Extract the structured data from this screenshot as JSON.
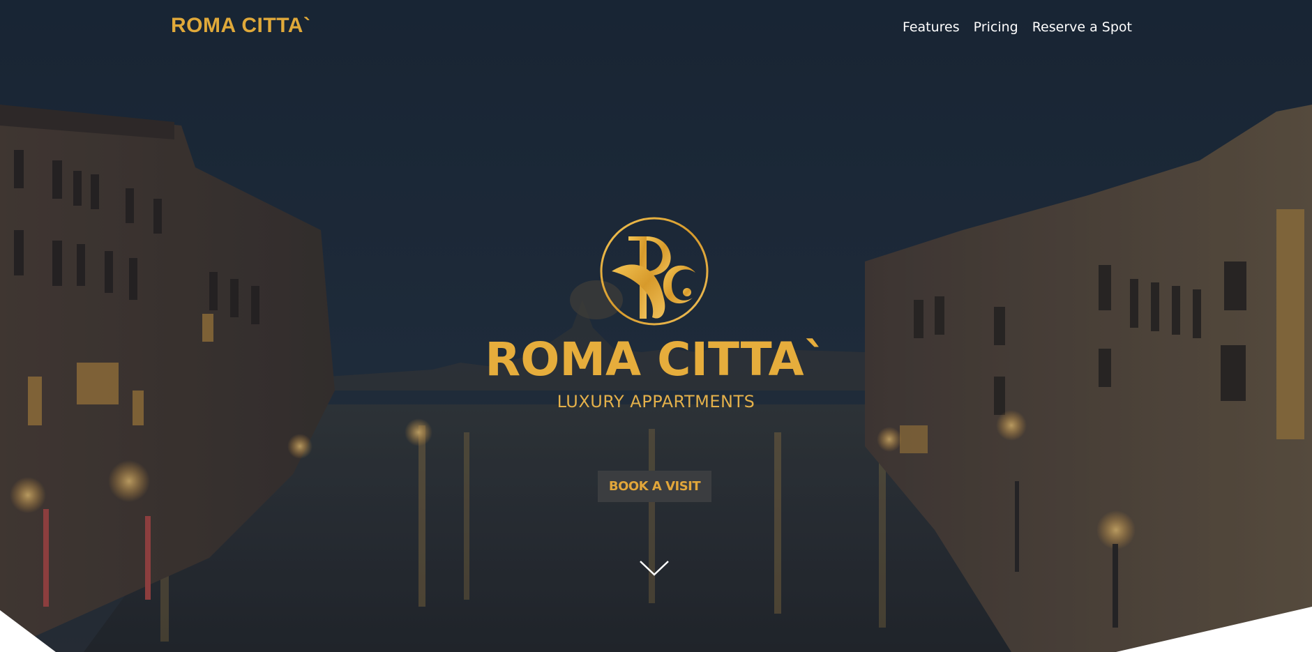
{
  "header": {
    "brand": "ROMA CITTA`",
    "nav": [
      {
        "label": "Features"
      },
      {
        "label": "Pricing"
      },
      {
        "label": "Reserve a Spot"
      }
    ]
  },
  "hero": {
    "logo_monogram": "RC",
    "title": "ROMA CITTA`",
    "subtitle": "LUXURY APPARTMENTS",
    "cta_label": "BOOK A VISIT",
    "scroll_icon": "chevron-down-icon",
    "background": "venice-canal-night-photo"
  },
  "colors": {
    "accent_gold": "#e0a93a",
    "nav_text": "#ffffff",
    "button_bg": "#3b3d40",
    "sky": "#1c2a3a"
  }
}
